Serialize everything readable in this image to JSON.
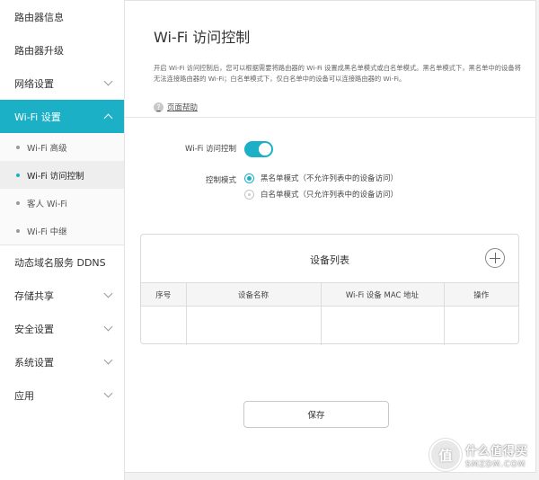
{
  "sidebar": {
    "items_top": [
      {
        "label": "路由器信息"
      },
      {
        "label": "路由器升级"
      },
      {
        "label": "网络设置"
      }
    ],
    "active_section": {
      "label": "Wi-Fi 设置"
    },
    "submenu": [
      {
        "label": "Wi-Fi 高级"
      },
      {
        "label": "Wi-Fi 访问控制"
      },
      {
        "label": "客人 Wi-Fi"
      },
      {
        "label": "Wi-Fi 中继"
      }
    ],
    "items_bottom": [
      {
        "label": "动态域名服务 DDNS"
      },
      {
        "label": "存储共享"
      },
      {
        "label": "安全设置"
      },
      {
        "label": "系统设置"
      },
      {
        "label": "应用"
      }
    ]
  },
  "main": {
    "title": "Wi-Fi 访问控制",
    "description": "开启 Wi-Fi 访问控制后，您可以根据需要将路由器的 Wi-Fi 设置成黑名单模式或白名单模式。黑名单模式下，黑名单中的设备将无法连接路由器的 Wi-Fi；白名单模式下，仅白名单中的设备可以连接路由器的 Wi-Fi。",
    "help_icon": "?",
    "help_link": "页面帮助",
    "toggle_label": "Wi-Fi 访问控制",
    "toggle_on": true,
    "mode_label": "控制模式",
    "modes": [
      {
        "label": "黑名单模式（不允许列表中的设备访问）",
        "checked": true
      },
      {
        "label": "白名单模式（只允许列表中的设备访问）",
        "checked": false
      }
    ],
    "device_list": {
      "title": "设备列表",
      "columns": [
        "序号",
        "设备名称",
        "Wi-Fi 设备 MAC 地址",
        "操作"
      ],
      "rows": []
    },
    "save_label": "保存"
  },
  "watermark": {
    "badge": "值",
    "text_cn": "什么值得买",
    "text_en": "SMZDM.COM"
  },
  "colors": {
    "accent": "#1bb0c6"
  }
}
